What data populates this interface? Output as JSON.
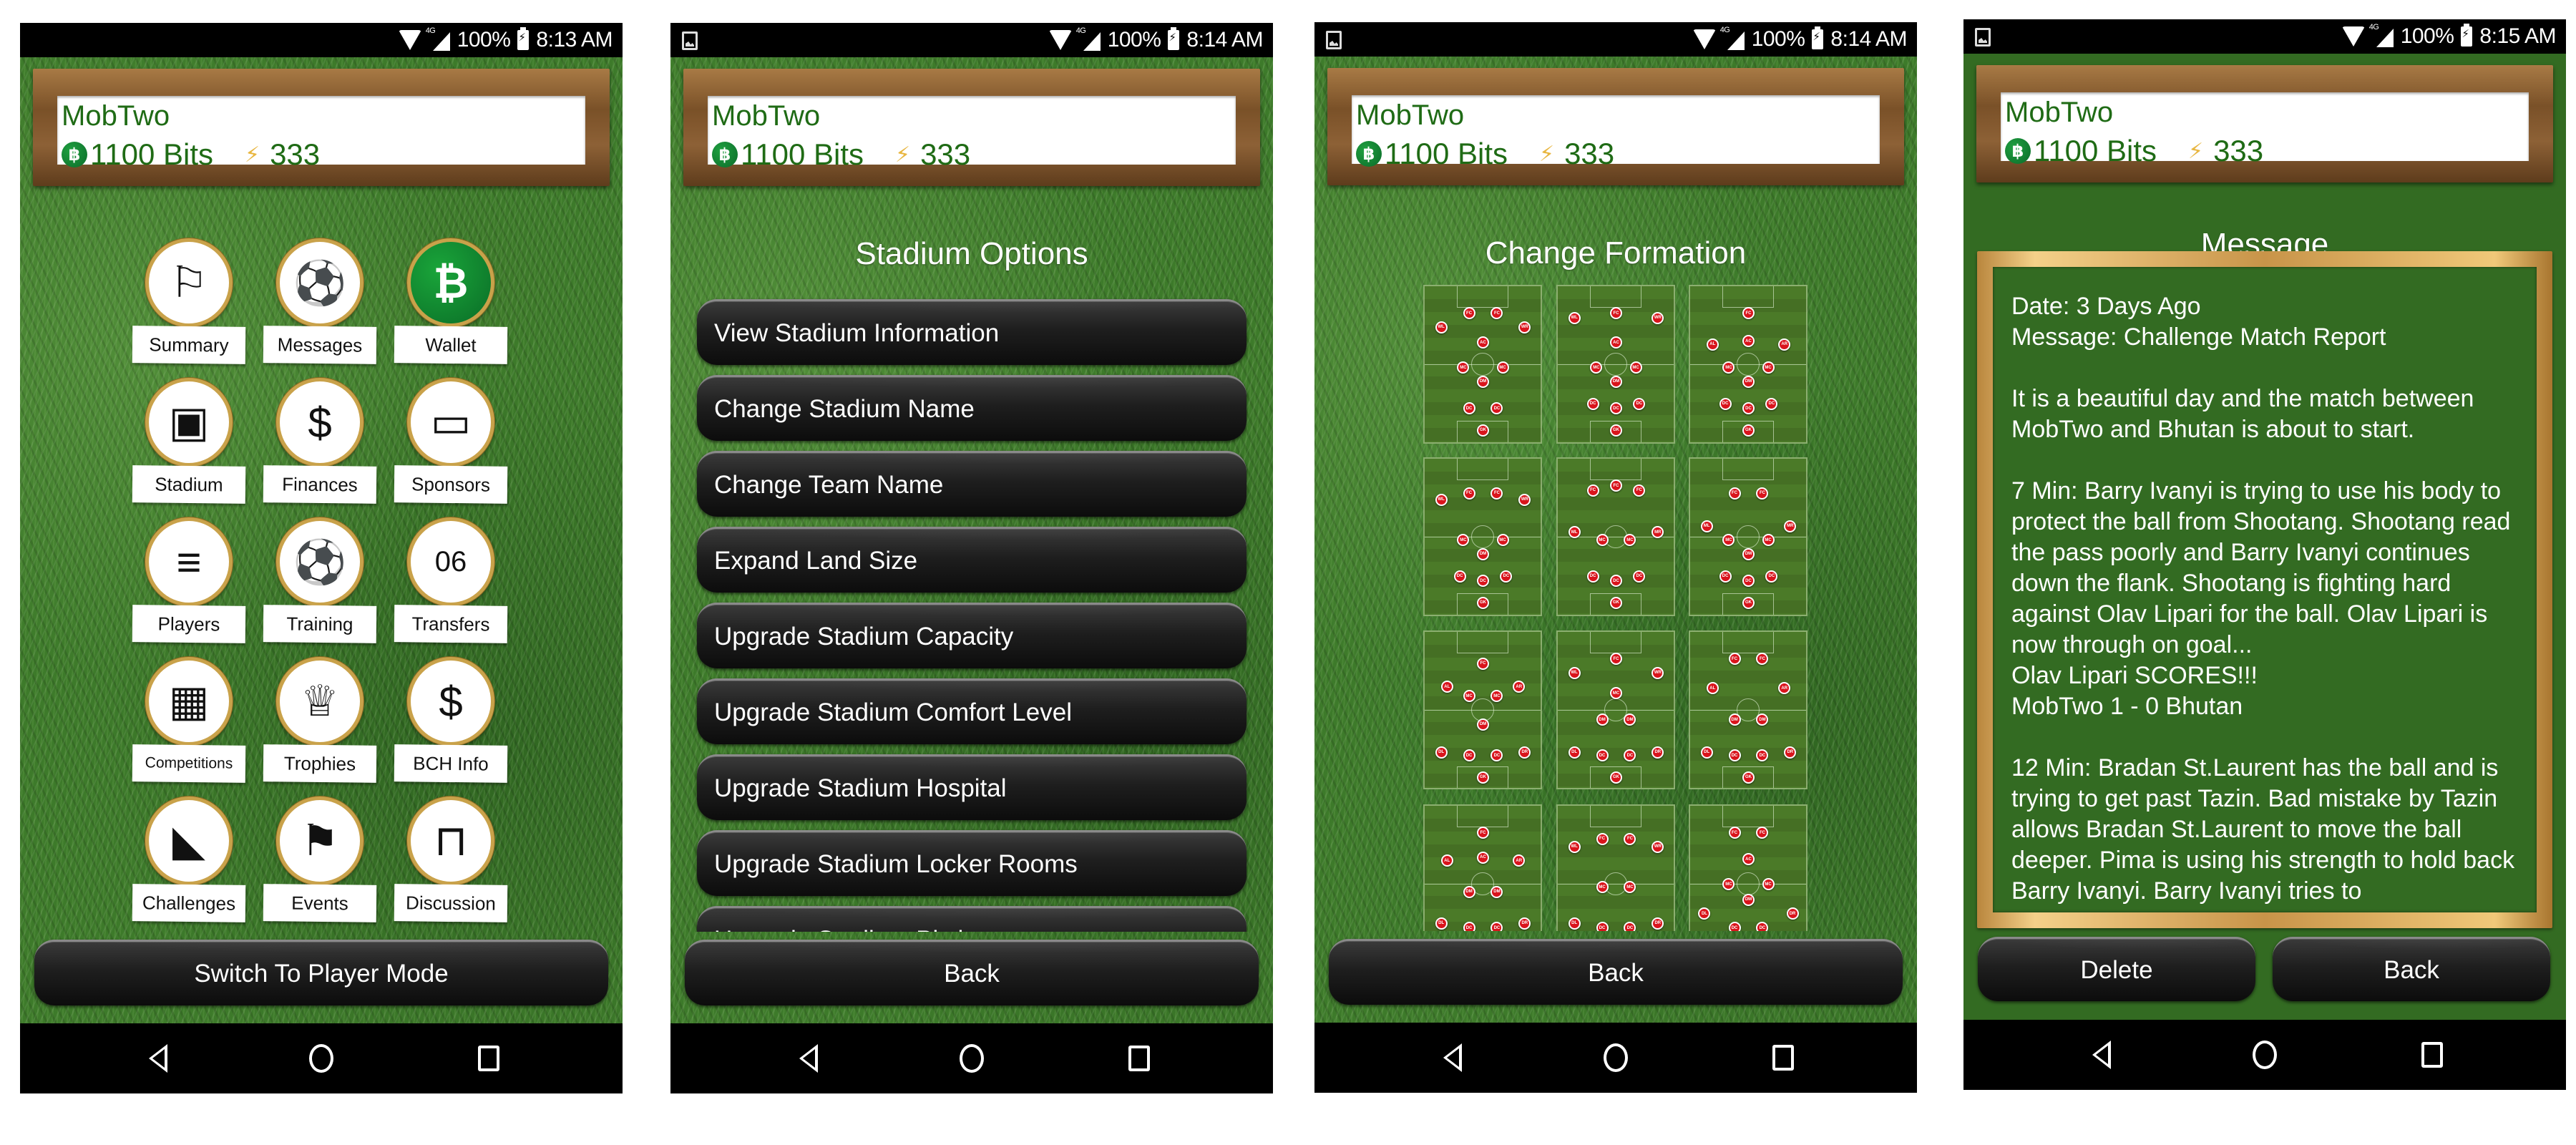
{
  "phones": [
    {
      "status": {
        "battery": "100%",
        "time": "8:13 AM",
        "network": "4G",
        "has_screenshot_icon": false
      },
      "header": {
        "team_name": "MobTwo",
        "bits": "1100 Bits",
        "energy": "333"
      },
      "menu": [
        {
          "label": "Summary",
          "icon": "pennant-icon",
          "glyph": "⚐"
        },
        {
          "label": "Messages",
          "icon": "satellite-ball-icon",
          "glyph": "⚽"
        },
        {
          "label": "Wallet",
          "icon": "bitcoin-cash-icon",
          "glyph": "₿"
        },
        {
          "label": "Stadium",
          "icon": "stadium-icon",
          "glyph": "▣"
        },
        {
          "label": "Finances",
          "icon": "coin-exchange-icon",
          "glyph": "$"
        },
        {
          "label": "Sponsors",
          "icon": "monitor-ad-icon",
          "glyph": "▭"
        },
        {
          "label": "Players",
          "icon": "jersey-icon",
          "glyph": "≡"
        },
        {
          "label": "Training",
          "icon": "kick-ball-icon",
          "glyph": "⚽"
        },
        {
          "label": "Transfers",
          "icon": "jersey-transfer-icon",
          "glyph": "06"
        },
        {
          "label": "Competitions",
          "icon": "scoreboard-icon",
          "glyph": "▦"
        },
        {
          "label": "Trophies",
          "icon": "trophy-icon",
          "glyph": "♕"
        },
        {
          "label": "BCH Info",
          "icon": "money-bag-icon",
          "glyph": "$"
        },
        {
          "label": "Challenges",
          "icon": "football-boot-icon",
          "glyph": "◣"
        },
        {
          "label": "Events",
          "icon": "checkered-flag-icon",
          "glyph": "⚑"
        },
        {
          "label": "Discussion",
          "icon": "seats-icon",
          "glyph": "⊓"
        },
        {
          "label": "",
          "icon": "ticket-icon",
          "glyph": "▤"
        },
        {
          "label": "",
          "icon": "ball-icon",
          "glyph": "⚽"
        },
        {
          "label": "",
          "icon": "pointer-hand-icon",
          "glyph": "☝"
        }
      ],
      "bottom_button": "Switch To Player Mode"
    },
    {
      "status": {
        "battery": "100%",
        "time": "8:14 AM",
        "network": "4G",
        "has_screenshot_icon": true
      },
      "header": {
        "team_name": "MobTwo",
        "bits": "1100 Bits",
        "energy": "333"
      },
      "title": "Stadium Options",
      "options": [
        "View Stadium Information",
        "Change Stadium Name",
        "Change Team Name",
        "Expand Land Size",
        "Upgrade Stadium Capacity",
        "Upgrade Stadium Comfort Level",
        "Upgrade Stadium Hospital",
        "Upgrade Stadium Locker Rooms",
        "Upgrade Stadium Pitch"
      ],
      "bottom_button": "Back"
    },
    {
      "status": {
        "battery": "100%",
        "time": "8:14 AM",
        "network": "4G",
        "has_screenshot_icon": true
      },
      "header": {
        "team_name": "MobTwo",
        "bits": "1100 Bits",
        "energy": "333"
      },
      "title": "Change Formation",
      "formations": [
        [
          [
            "FC",
            0.38,
            0.17
          ],
          [
            "FC",
            0.62,
            0.17
          ],
          [
            "WL",
            0.14,
            0.26
          ],
          [
            "WR",
            0.86,
            0.26
          ],
          [
            "AC",
            0.5,
            0.36
          ],
          [
            "MC",
            0.33,
            0.52
          ],
          [
            "MC",
            0.67,
            0.52
          ],
          [
            "DM",
            0.5,
            0.61
          ],
          [
            "DC",
            0.38,
            0.78
          ],
          [
            "DC",
            0.62,
            0.78
          ],
          [
            "GK",
            0.5,
            0.92
          ]
        ],
        [
          [
            "FC",
            0.5,
            0.17
          ],
          [
            "WL",
            0.14,
            0.2
          ],
          [
            "WR",
            0.86,
            0.2
          ],
          [
            "AC",
            0.5,
            0.36
          ],
          [
            "MC",
            0.33,
            0.52
          ],
          [
            "MC",
            0.67,
            0.52
          ],
          [
            "DM",
            0.5,
            0.61
          ],
          [
            "DC",
            0.3,
            0.75
          ],
          [
            "DC",
            0.5,
            0.78
          ],
          [
            "DC",
            0.7,
            0.75
          ],
          [
            "GK",
            0.5,
            0.92
          ]
        ],
        [
          [
            "FC",
            0.5,
            0.17
          ],
          [
            "AL",
            0.19,
            0.37
          ],
          [
            "AC",
            0.5,
            0.35
          ],
          [
            "AR",
            0.81,
            0.37
          ],
          [
            "MC",
            0.33,
            0.52
          ],
          [
            "MC",
            0.67,
            0.52
          ],
          [
            "DM",
            0.5,
            0.61
          ],
          [
            "DC",
            0.3,
            0.75
          ],
          [
            "DC",
            0.5,
            0.78
          ],
          [
            "DC",
            0.7,
            0.75
          ],
          [
            "GK",
            0.5,
            0.92
          ]
        ],
        [
          [
            "FC",
            0.38,
            0.22
          ],
          [
            "FC",
            0.62,
            0.22
          ],
          [
            "WL",
            0.14,
            0.26
          ],
          [
            "WR",
            0.86,
            0.26
          ],
          [
            "MC",
            0.33,
            0.52
          ],
          [
            "MC",
            0.67,
            0.52
          ],
          [
            "DM",
            0.5,
            0.61
          ],
          [
            "DC",
            0.3,
            0.75
          ],
          [
            "DC",
            0.5,
            0.78
          ],
          [
            "DC",
            0.7,
            0.75
          ],
          [
            "GK",
            0.5,
            0.92
          ]
        ],
        [
          [
            "FC",
            0.3,
            0.2
          ],
          [
            "FC",
            0.5,
            0.17
          ],
          [
            "FC",
            0.7,
            0.2
          ],
          [
            "ML",
            0.14,
            0.47
          ],
          [
            "MR",
            0.86,
            0.47
          ],
          [
            "MC",
            0.38,
            0.52
          ],
          [
            "MC",
            0.62,
            0.52
          ],
          [
            "DC",
            0.3,
            0.75
          ],
          [
            "DC",
            0.5,
            0.78
          ],
          [
            "DC",
            0.7,
            0.75
          ],
          [
            "GK",
            0.5,
            0.92
          ]
        ],
        [
          [
            "FC",
            0.38,
            0.22
          ],
          [
            "FC",
            0.62,
            0.22
          ],
          [
            "ML",
            0.14,
            0.43
          ],
          [
            "MR",
            0.86,
            0.43
          ],
          [
            "MC",
            0.33,
            0.52
          ],
          [
            "MC",
            0.67,
            0.52
          ],
          [
            "DM",
            0.5,
            0.61
          ],
          [
            "DC",
            0.3,
            0.75
          ],
          [
            "DC",
            0.5,
            0.78
          ],
          [
            "DC",
            0.7,
            0.75
          ],
          [
            "GK",
            0.5,
            0.92
          ]
        ],
        [
          [
            "FC",
            0.5,
            0.2
          ],
          [
            "AL",
            0.19,
            0.35
          ],
          [
            "AR",
            0.81,
            0.35
          ],
          [
            "MC",
            0.38,
            0.41
          ],
          [
            "MC",
            0.62,
            0.41
          ],
          [
            "DM",
            0.5,
            0.59
          ],
          [
            "DL",
            0.14,
            0.77
          ],
          [
            "DC",
            0.38,
            0.79
          ],
          [
            "DC",
            0.62,
            0.79
          ],
          [
            "DR",
            0.86,
            0.77
          ],
          [
            "GK",
            0.5,
            0.93
          ]
        ],
        [
          [
            "FC",
            0.5,
            0.17
          ],
          [
            "WL",
            0.14,
            0.26
          ],
          [
            "WR",
            0.86,
            0.26
          ],
          [
            "MC",
            0.5,
            0.39
          ],
          [
            "DM",
            0.38,
            0.56
          ],
          [
            "DM",
            0.62,
            0.56
          ],
          [
            "DL",
            0.14,
            0.77
          ],
          [
            "DC",
            0.38,
            0.79
          ],
          [
            "DC",
            0.62,
            0.79
          ],
          [
            "DR",
            0.86,
            0.77
          ],
          [
            "GK",
            0.5,
            0.93
          ]
        ],
        [
          [
            "FC",
            0.38,
            0.17
          ],
          [
            "FC",
            0.62,
            0.17
          ],
          [
            "AL",
            0.19,
            0.36
          ],
          [
            "AR",
            0.81,
            0.36
          ],
          [
            "DM",
            0.38,
            0.56
          ],
          [
            "DM",
            0.62,
            0.56
          ],
          [
            "DL",
            0.14,
            0.77
          ],
          [
            "DC",
            0.38,
            0.79
          ],
          [
            "DC",
            0.62,
            0.79
          ],
          [
            "DR",
            0.86,
            0.77
          ],
          [
            "GK",
            0.5,
            0.93
          ]
        ],
        [
          [
            "FC",
            0.5,
            0.17
          ],
          [
            "AL",
            0.19,
            0.35
          ],
          [
            "AC",
            0.5,
            0.33
          ],
          [
            "AR",
            0.81,
            0.35
          ],
          [
            "DM",
            0.38,
            0.55
          ],
          [
            "DM",
            0.62,
            0.55
          ],
          [
            "DL",
            0.14,
            0.75
          ],
          [
            "DC",
            0.38,
            0.78
          ],
          [
            "DC",
            0.62,
            0.78
          ],
          [
            "DR",
            0.86,
            0.75
          ],
          [
            "GK",
            0.5,
            0.92
          ]
        ],
        [
          [
            "FC",
            0.38,
            0.21
          ],
          [
            "FC",
            0.62,
            0.21
          ],
          [
            "WL",
            0.14,
            0.26
          ],
          [
            "WR",
            0.86,
            0.26
          ],
          [
            "MC",
            0.38,
            0.52
          ],
          [
            "MC",
            0.62,
            0.52
          ],
          [
            "DL",
            0.14,
            0.75
          ],
          [
            "DC",
            0.38,
            0.78
          ],
          [
            "DC",
            0.62,
            0.78
          ],
          [
            "DR",
            0.86,
            0.75
          ],
          [
            "GK",
            0.5,
            0.92
          ]
        ],
        [
          [
            "FC",
            0.38,
            0.17
          ],
          [
            "FC",
            0.62,
            0.17
          ],
          [
            "AC",
            0.5,
            0.34
          ],
          [
            "MC",
            0.33,
            0.5
          ],
          [
            "MC",
            0.67,
            0.5
          ],
          [
            "DM",
            0.5,
            0.6
          ],
          [
            "DL",
            0.12,
            0.69
          ],
          [
            "DR",
            0.88,
            0.69
          ],
          [
            "DC",
            0.38,
            0.78
          ],
          [
            "DC",
            0.62,
            0.78
          ],
          [
            "GK",
            0.5,
            0.92
          ]
        ]
      ],
      "bottom_button": "Back"
    },
    {
      "status": {
        "battery": "100%",
        "time": "8:15 AM",
        "network": "4G",
        "has_screenshot_icon": true
      },
      "header": {
        "team_name": "MobTwo",
        "bits": "1100 Bits",
        "energy": "333"
      },
      "title": "Message",
      "message": {
        "date": "Date: 3 Days Ago",
        "subject": "Message: Challenge Match Report",
        "body": "It is a beautiful day and the match between MobTwo and Bhutan is about to start.\n\n7 Min: Barry Ivanyi is trying to use his body to protect the ball from Shootang. Shootang read the pass poorly and Barry Ivanyi continues down the flank. Shootang is fighting hard against Olav Lipari for the ball. Olav Lipari is now through on goal...\nOlav Lipari SCORES!!!\nMobTwo 1 - 0 Bhutan\n\n12 Min: Bradan St.Laurent has the ball and is trying to get past Tazin. Bad mistake by Tazin allows Bradan St.Laurent to move the ball deeper. Pima is using his strength to hold back Barry Ivanyi. Barry Ivanyi tries to"
      },
      "buttons": {
        "delete": "Delete",
        "back": "Back"
      }
    }
  ],
  "colors": {
    "team_green": "#1f6b15",
    "message_bg": "#336b22",
    "player_dot": "#d9141c",
    "frame_gold": "#c9a24a"
  }
}
